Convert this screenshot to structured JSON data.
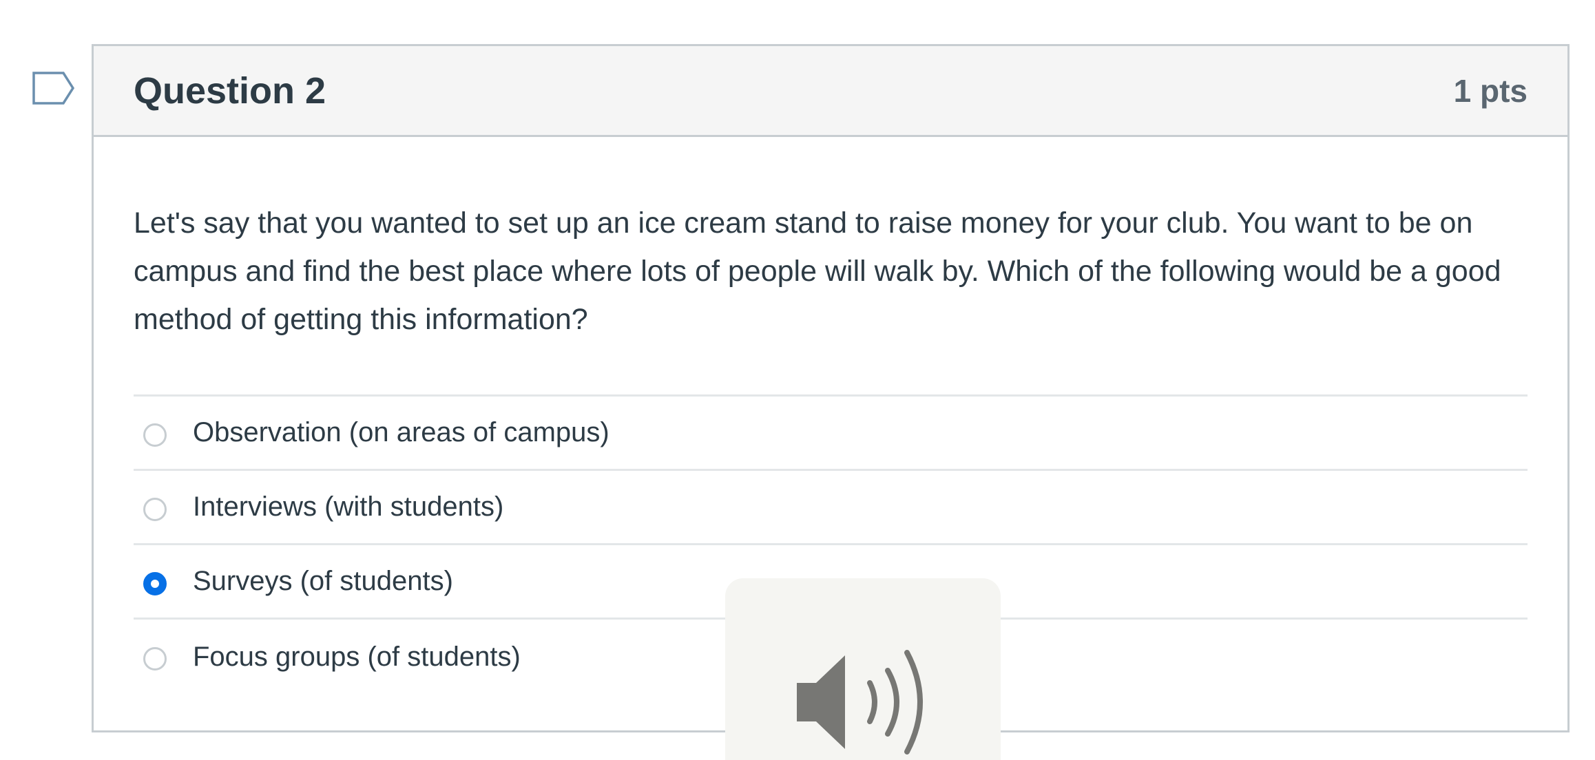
{
  "question": {
    "title": "Question 2",
    "points": "1 pts",
    "text": "Let's say that you wanted to set up an ice cream stand to raise money for your club. You want to be on campus and find the best place where lots of people will walk by. Which of the following would be a good method of getting this information?",
    "selected_index": 2,
    "answers": [
      {
        "label": "Observation (on areas of campus)",
        "checked": false
      },
      {
        "label": "Interviews (with students)",
        "checked": false
      },
      {
        "label": "Surveys (of students)",
        "checked": true
      },
      {
        "label": "Focus groups (of students)",
        "checked": false
      }
    ]
  },
  "icons": {
    "flag": "flag-question-icon",
    "speaker": "speaker-icon"
  },
  "colors": {
    "accent": "#0770e6",
    "header_bg": "#f5f5f5",
    "border": "#c7cdd1",
    "text": "#2d3b45"
  }
}
